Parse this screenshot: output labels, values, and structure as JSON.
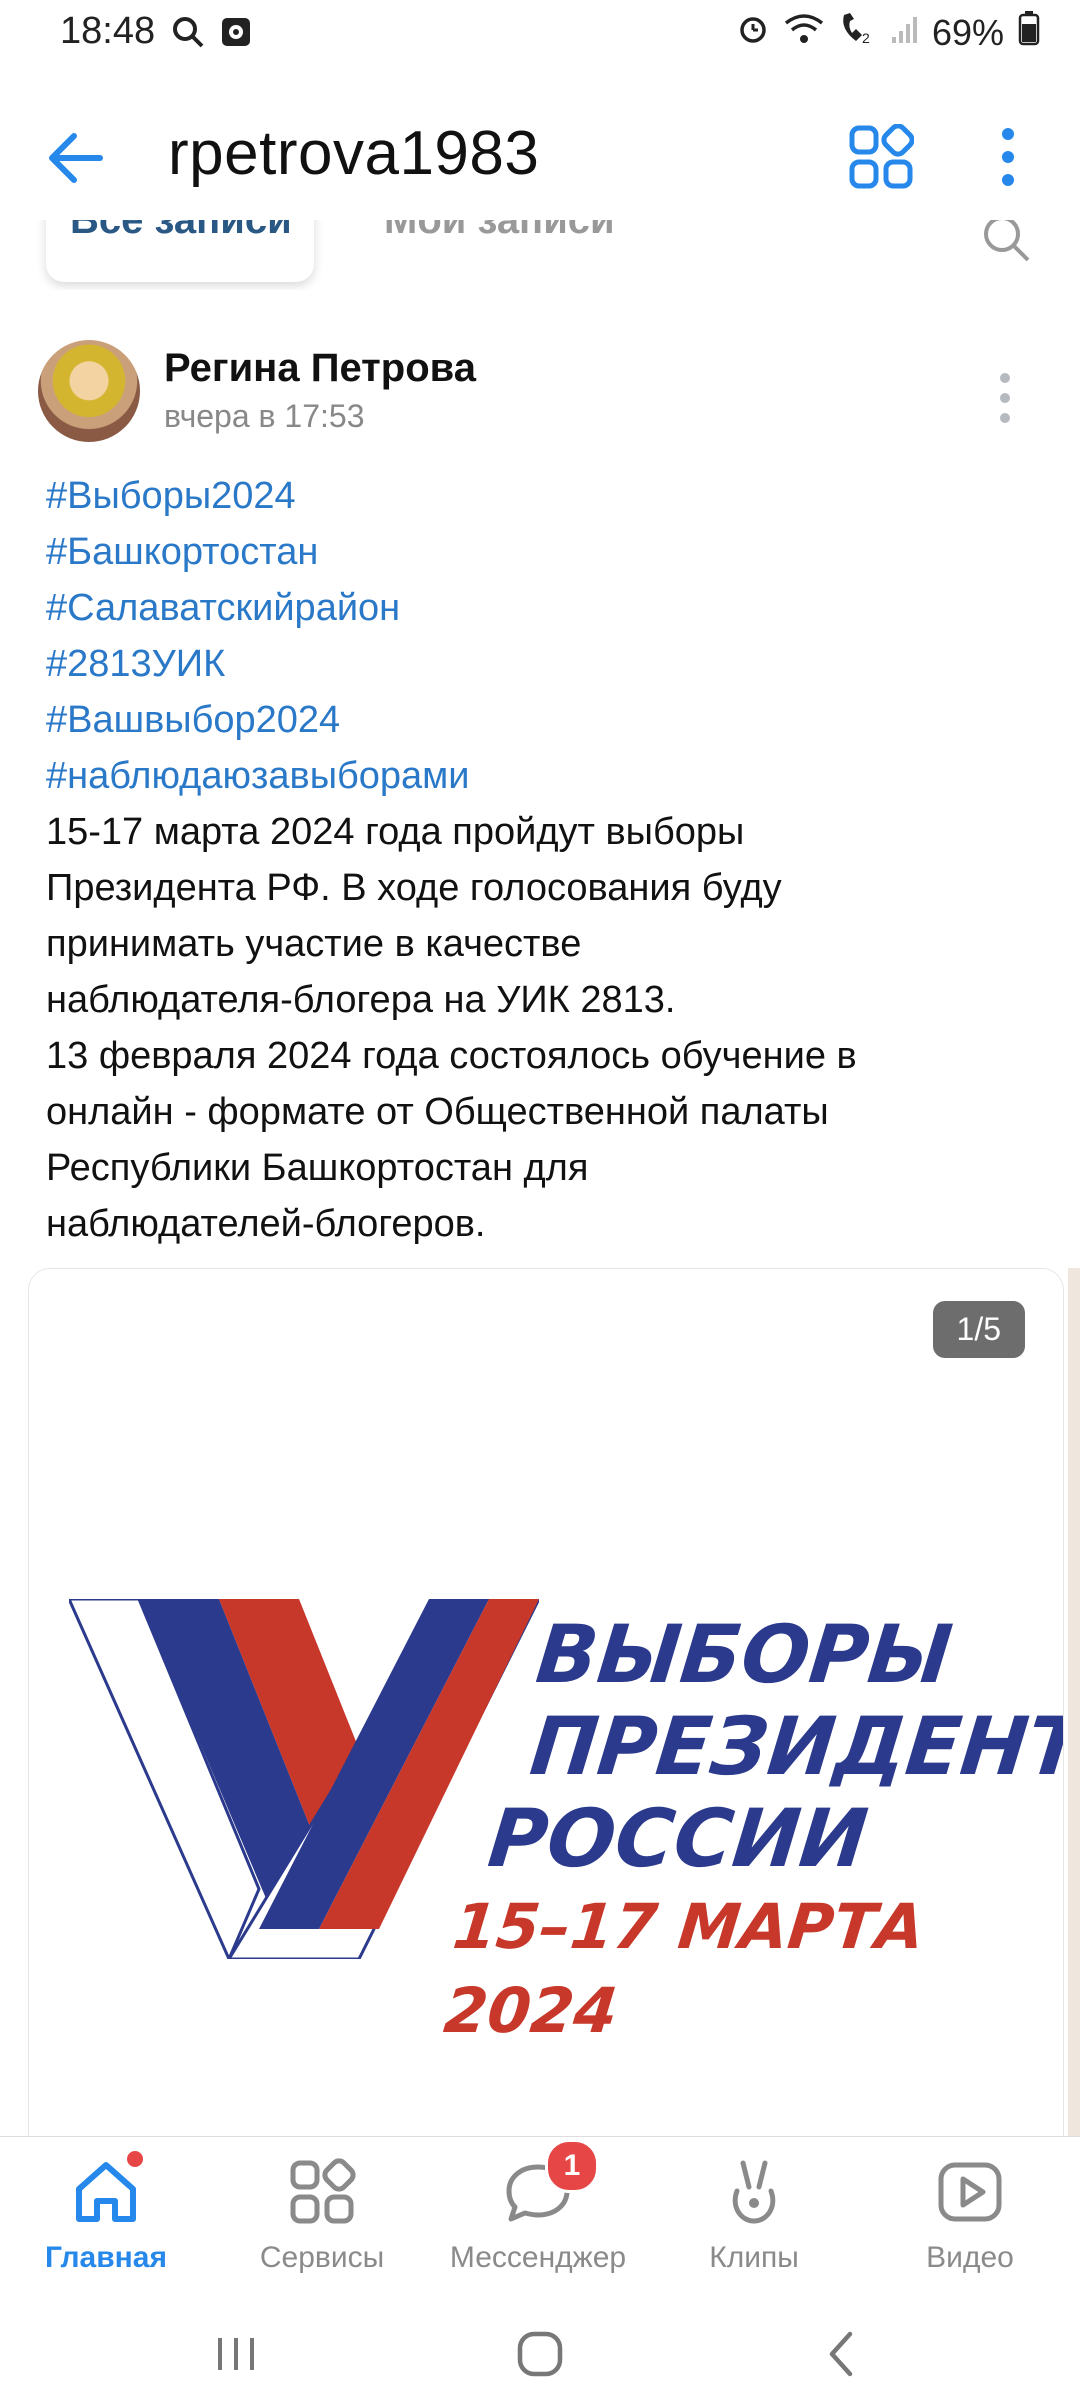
{
  "status": {
    "time": "18:48",
    "battery": "69%"
  },
  "header": {
    "title": "rpetrova1983"
  },
  "tabs": {
    "all": "Все записи",
    "mine": "Мои записи"
  },
  "post": {
    "author": "Регина Петрова",
    "date": "вчера в 17:53",
    "tags": [
      "#Выборы2024",
      "#Башкортостан",
      "#Салаватскийрайон",
      "#2813УИК",
      "#Вашвыбор2024",
      "#наблюдаюзавыборами"
    ],
    "lines": [
      "15-17 марта 2024 года пройдут выборы",
      "Президента РФ. В ходе голосования буду",
      "принимать участие в качестве",
      "наблюдателя-блогера на УИК 2813.",
      "13 февраля 2024 года состоялось обучение в",
      "онлайн - формате от Общественной палаты",
      "Республики Башкортостан для",
      "наблюдателей-блогеров."
    ],
    "media": {
      "counter": "1/5",
      "logo_line1": "ВЫБОРЫ",
      "logo_line2": "ПРЕЗИДЕНТА",
      "logo_line3": "РОССИИ",
      "logo_line4": "15–17 МАРТА 2024"
    }
  },
  "nav": {
    "home": "Главная",
    "services": "Сервисы",
    "messenger": "Мессенджер",
    "messenger_badge": "1",
    "clips": "Клипы",
    "video": "Видео"
  },
  "colors": {
    "accent": "#2688eb",
    "link": "#2a78c8",
    "badge": "#e64646"
  }
}
